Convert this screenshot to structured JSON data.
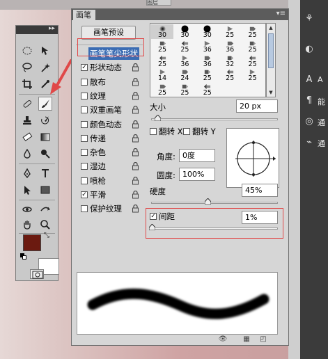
{
  "background": {
    "layers_tab_fragment": "图层",
    "right_panel_labels": [
      "A",
      "能",
      "通",
      "通"
    ]
  },
  "toolbox": {
    "collapse_glyph": "▸▸",
    "tools": [
      "marquee",
      "move",
      "lasso",
      "magic-wand",
      "crop",
      "eyedropper",
      "healing-brush",
      "brush",
      "clone-stamp",
      "history-brush",
      "eraser",
      "gradient",
      "blur",
      "dodge",
      "pen",
      "type",
      "path-selection",
      "rectangle",
      "3d-rotate",
      "3d-orbit",
      "hand",
      "zoom"
    ],
    "foreground_color": "#6b1a10",
    "background_color": "#ffffff"
  },
  "panel": {
    "tab_label": "画笔",
    "menu_glyph": "▾≡",
    "top_buttons": "▸▸  ✕",
    "preset_button": "画笔预设",
    "options": [
      {
        "label": "画笔笔尖形状",
        "checked": false,
        "selected": true
      },
      {
        "label": "形状动态",
        "checked": true
      },
      {
        "label": "散布",
        "checked": false
      },
      {
        "label": "纹理",
        "checked": false
      },
      {
        "label": "双重画笔",
        "checked": false
      },
      {
        "label": "颜色动态",
        "checked": false
      },
      {
        "label": "传递",
        "checked": false
      },
      {
        "label": "杂色",
        "checked": false
      },
      {
        "label": "湿边",
        "checked": false
      },
      {
        "label": "喷枪",
        "checked": false
      },
      {
        "label": "平滑",
        "checked": true
      },
      {
        "label": "保护纹理",
        "checked": false
      }
    ],
    "brush_sizes": [
      30,
      30,
      30,
      25,
      25,
      25,
      25,
      36,
      36,
      25,
      25,
      36,
      36,
      32,
      25,
      14,
      24,
      25,
      25,
      25,
      25,
      25,
      25
    ],
    "brush_icons": [
      "soft-round",
      "hard-round",
      "hard-round",
      "bristle",
      "bristle",
      "bristle",
      "bristle",
      "bristle",
      "bristle",
      "bristle",
      "bristle",
      "bristle",
      "bristle",
      "bristle",
      "bristle",
      "bristle",
      "bristle",
      "bristle",
      "bristle",
      "bristle",
      "bristle",
      "bristle",
      "bristle"
    ],
    "size_label": "大小",
    "size_value": "20 px",
    "size_fraction": 0.05,
    "flip_x_label": "翻转 X",
    "flip_y_label": "翻转 Y",
    "angle_label": "角度:",
    "angle_value": "0度",
    "roundness_label": "圆度:",
    "roundness_value": "100%",
    "hardness_label": "硬度",
    "hardness_value": "45%",
    "hardness_fraction": 0.45,
    "spacing_label": "间距",
    "spacing_checked": true,
    "spacing_value": "1%",
    "spacing_fraction": 0.01
  },
  "accent_red": "#e04848",
  "selection_blue": "#3b6cb3"
}
